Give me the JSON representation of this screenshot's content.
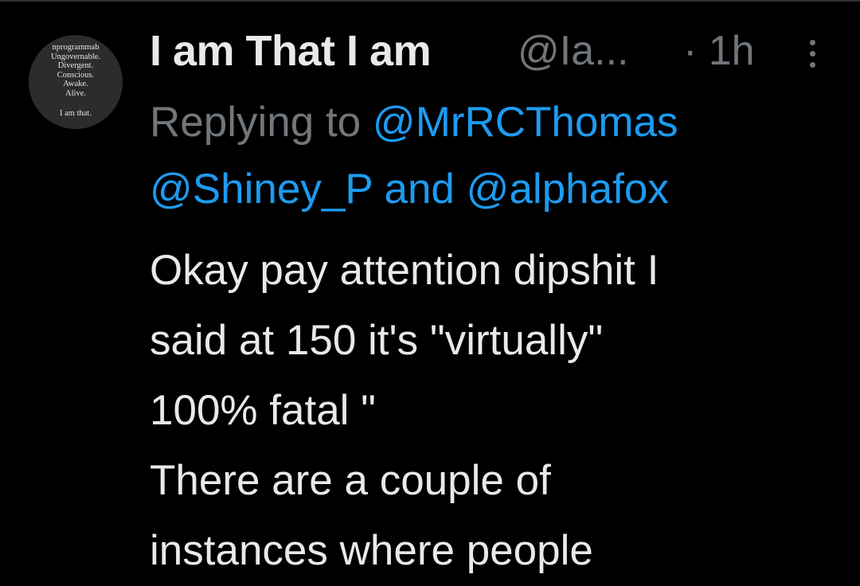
{
  "tweet": {
    "avatar_lines": [
      "nprogrammab",
      "Ungovernable.",
      "Divergent.",
      "Conscious.",
      "Awake.",
      "Alive.",
      "I am that."
    ],
    "display_name": "I am That I am",
    "handle": "@Ia...",
    "time": "· 1h",
    "more_icon": "more-vertical-icon",
    "replying_prefix": "Replying to",
    "reply_mention_1": "@MrRCThomas",
    "reply_mention_2": "@Shiney_P",
    "reply_joiner": "and",
    "reply_mention_3": "@alphafox",
    "body_lines": [
      "Okay pay attention dipshit I",
      "said at 150 it's \"virtually\"",
      "100% fatal \"",
      "There are a couple of",
      "instances where people"
    ]
  },
  "colors": {
    "background": "#000000",
    "text_primary": "#e7e9ea",
    "text_secondary": "#71767b",
    "link": "#1d9bf0"
  }
}
